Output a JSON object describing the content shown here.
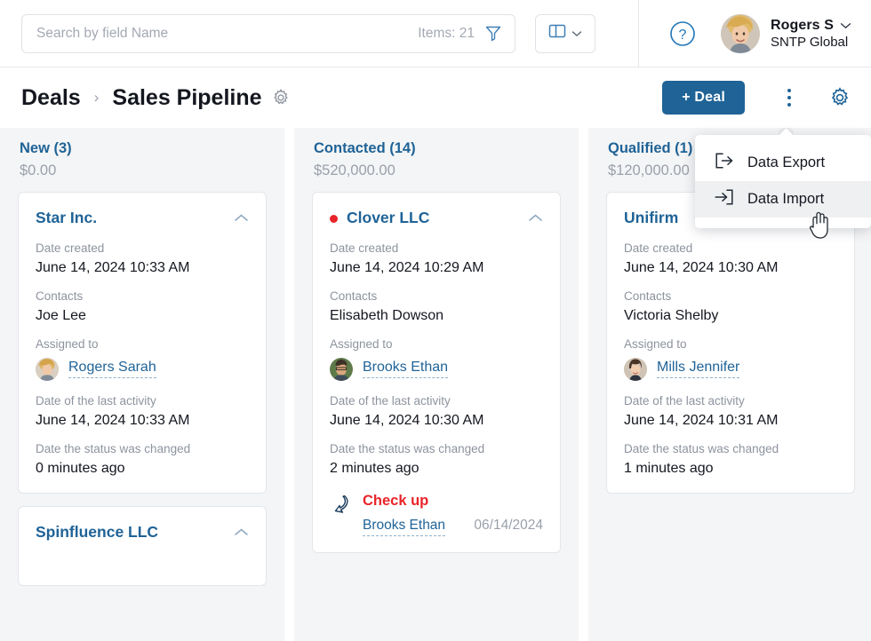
{
  "topbar": {
    "search": {
      "placeholder": "Search by field Name",
      "value": ""
    },
    "items_label": "Items: 21",
    "filter_icon": "filter-funnel-icon",
    "view_icon": "columns-view-icon",
    "view_chevron_icon": "chevron-down-icon",
    "help_icon": "question-circle-icon",
    "user": {
      "name": "Rogers S",
      "org": "SNTP Global",
      "chevron_icon": "chevron-down-icon",
      "avatar": "user-avatar"
    }
  },
  "pagehead": {
    "breadcrumb_root": "Deals",
    "breadcrumb_sep": "›",
    "breadcrumb_current": "Sales Pipeline",
    "settings_icon": "gear-icon",
    "add_deal_label": "+ Deal",
    "kebab_icon": "more-vertical-icon",
    "gear_icon": "gear-icon"
  },
  "dropdown": {
    "items": [
      {
        "label": "Data Export",
        "icon": "export-arrow-icon",
        "active": false
      },
      {
        "label": "Data Import",
        "icon": "import-arrow-icon",
        "active": true
      }
    ]
  },
  "labels": {
    "date_created": "Date created",
    "contacts": "Contacts",
    "assigned_to": "Assigned to",
    "last_activity": "Date of the last activity",
    "status_changed": "Date the status was changed",
    "collapse_icon": "chevron-up-icon"
  },
  "colors": {
    "accent": "#1f6397",
    "danger": "#e8252a",
    "muted": "#8d939e",
    "column_bg": "#f4f5f6"
  },
  "columns": [
    {
      "title": "New (3)",
      "sum": "$0.00",
      "cards": [
        {
          "title": "Star Inc.",
          "flagged": false,
          "date_created": "June 14, 2024 10:33 AM",
          "contacts": "Joe Lee",
          "assignee": "Rogers Sarah",
          "last_activity": "June 14, 2024 10:33 AM",
          "status_changed": "0 minutes ago",
          "task": null
        },
        {
          "title": "Spinfluence LLC",
          "flagged": false,
          "date_created": "",
          "contacts": "",
          "assignee": "",
          "last_activity": "",
          "status_changed": "",
          "task": null
        }
      ]
    },
    {
      "title": "Contacted (14)",
      "sum": "$520,000.00",
      "cards": [
        {
          "title": "Clover LLC",
          "flagged": true,
          "date_created": "June 14, 2024 10:29 AM",
          "contacts": "Elisabeth Dowson",
          "assignee": "Brooks Ethan",
          "last_activity": "June 14, 2024 10:30 AM",
          "status_changed": "2 minutes ago",
          "task": {
            "icon": "phone-call-icon",
            "title": "Check up",
            "person": "Brooks Ethan",
            "date": "06/14/2024"
          }
        }
      ]
    },
    {
      "title": "Qualified (1)",
      "sum": "$120,000.00",
      "cards": [
        {
          "title": "Unifirm",
          "flagged": false,
          "date_created": "June 14, 2024 10:30 AM",
          "contacts": "Victoria Shelby",
          "assignee": "Mills Jennifer",
          "last_activity": "June 14, 2024 10:31 AM",
          "status_changed": "1 minutes ago",
          "task": null
        }
      ]
    }
  ]
}
